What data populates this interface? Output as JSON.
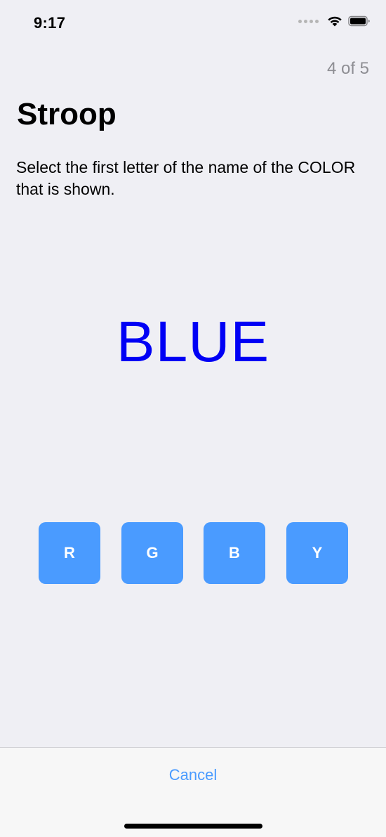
{
  "status_bar": {
    "time": "9:17"
  },
  "header": {
    "progress": "4 of 5",
    "title": "Stroop",
    "instruction": "Select the first letter of the name of the COLOR that is shown."
  },
  "stimulus": {
    "word": "BLUE",
    "color": "#0000F5"
  },
  "answers": {
    "options": [
      "R",
      "G",
      "B",
      "Y"
    ],
    "button_color": "#4A9BFF"
  },
  "footer": {
    "cancel_label": "Cancel"
  },
  "colors": {
    "background": "#EFEFF4",
    "accent": "#4A9BFF",
    "secondary_text": "#8E8E93"
  }
}
